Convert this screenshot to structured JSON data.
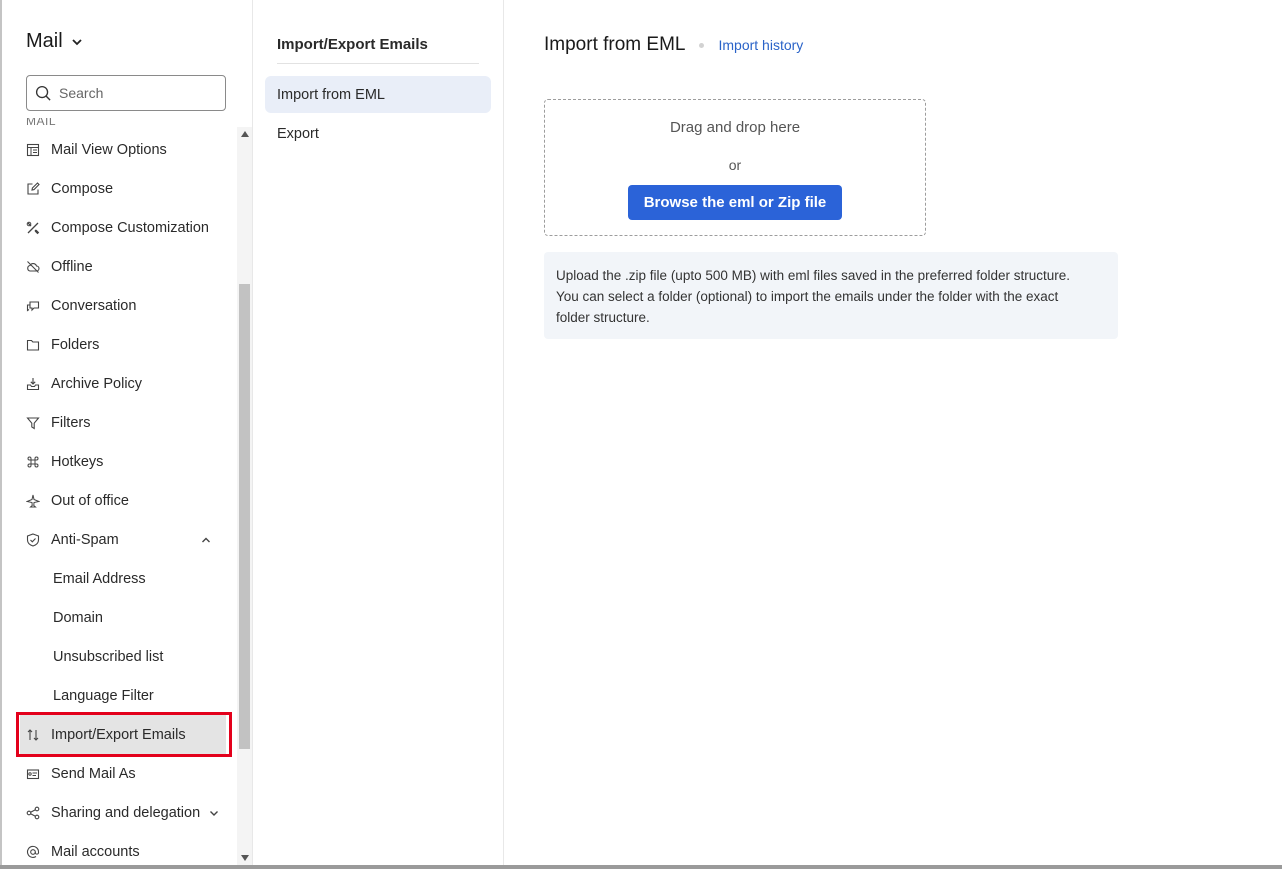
{
  "sidebar": {
    "app_title": "Mail",
    "search_placeholder": "Search",
    "section_label": "MAIL",
    "items": [
      {
        "label": "Mail View Options",
        "icon": "layout-icon"
      },
      {
        "label": "Compose",
        "icon": "edit-icon"
      },
      {
        "label": "Compose Customization",
        "icon": "tools-icon"
      },
      {
        "label": "Offline",
        "icon": "cloud-off-icon"
      },
      {
        "label": "Conversation",
        "icon": "chat-icon"
      },
      {
        "label": "Folders",
        "icon": "folder-icon"
      },
      {
        "label": "Archive Policy",
        "icon": "archive-icon"
      },
      {
        "label": "Filters",
        "icon": "filter-icon"
      },
      {
        "label": "Hotkeys",
        "icon": "command-icon"
      },
      {
        "label": "Out of office",
        "icon": "plane-icon"
      },
      {
        "label": "Anti-Spam",
        "icon": "shield-icon"
      },
      {
        "label": "Email Address"
      },
      {
        "label": "Domain"
      },
      {
        "label": "Unsubscribed list"
      },
      {
        "label": "Language Filter"
      },
      {
        "label": "Import/Export Emails",
        "icon": "swap-arrows-icon"
      },
      {
        "label": "Send Mail As",
        "icon": "send-as-icon"
      },
      {
        "label": "Sharing and delegation",
        "icon": "share-icon"
      },
      {
        "label": "Mail accounts",
        "icon": "at-icon"
      }
    ]
  },
  "subnav": {
    "title": "Import/Export Emails",
    "items": [
      {
        "label": "Import from EML"
      },
      {
        "label": "Export"
      }
    ]
  },
  "main": {
    "title": "Import from EML",
    "history_link": "Import history",
    "drop_text": "Drag and drop here",
    "or_text": "or",
    "browse_label": "Browse the eml or Zip file",
    "info_line1": "Upload the .zip file (upto 500 MB) with eml files saved in the preferred folder structure.",
    "info_line2": "You can select a folder (optional) to import the emails under the folder with the exact",
    "info_line3": "folder structure."
  },
  "colors": {
    "accent": "#2b63d8",
    "link": "#2a63c8",
    "highlight": "#e3001b",
    "selected_bg": "#e9eef8"
  }
}
